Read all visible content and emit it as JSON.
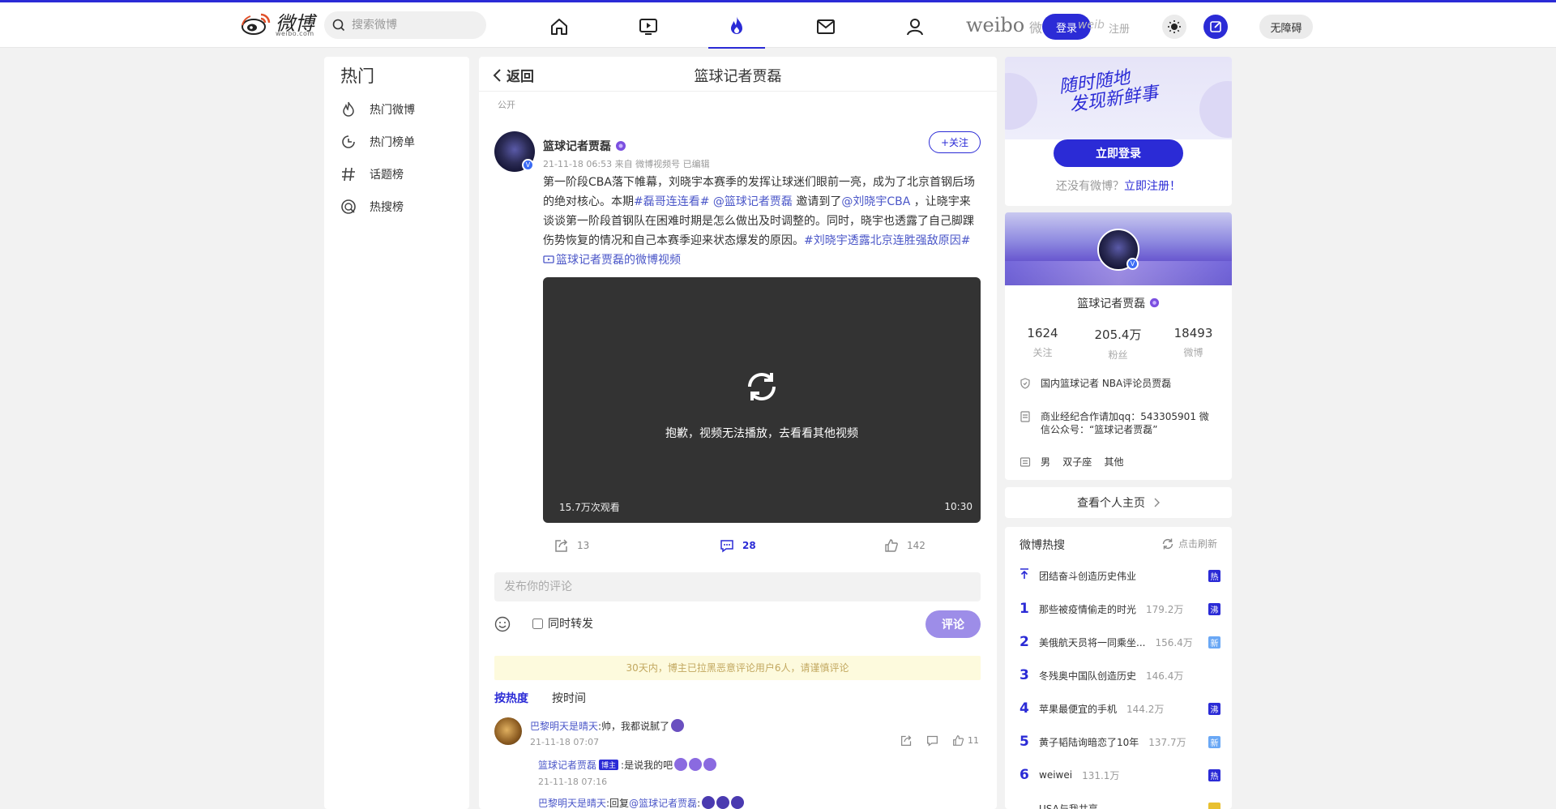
{
  "topbar": {
    "logo_text": "微博",
    "logo_sub": "weibo.com",
    "search_placeholder": "搜索微博",
    "weibo_word": "weibo",
    "weibo_shadow": "微",
    "login_label": "登录",
    "login_ghost": "weib",
    "register_ghost": "注册",
    "accessibility_label": "无障碍"
  },
  "leftnav": {
    "title": "热门",
    "items": [
      {
        "label": "热门微博",
        "icon": "flame-icon"
      },
      {
        "label": "热门榜单",
        "icon": "clock-chart-icon"
      },
      {
        "label": "话题榜",
        "icon": "hashtag-icon"
      },
      {
        "label": "热搜榜",
        "icon": "search-circle-icon"
      }
    ]
  },
  "post": {
    "back_label": "返回",
    "header_title": "篮球记者贾磊",
    "visibility": "公开",
    "author": "篮球记者贾磊",
    "meta": "21-11-18 06:53 来自 微博视频号 已编辑",
    "follow_label": "+关注",
    "body": {
      "p1": "第一阶段CBA落下帷幕，刘晓宇本赛季的发挥让球迷们眼前一亮，成为了北京首钢后场的绝对核心。本期",
      "tag1": "#磊哥连连看#",
      "mention1": "@篮球记者贾磊",
      "p2": " 邀请到了",
      "mention2": "@刘晓宇CBA",
      "p3": " ，让晓宇来谈谈第一阶段首钢队在困难时期是怎么做出及时调整的。同时，晓宇也透露了自己脚踝伤势恢复的情况和自己本赛季迎来状态爆发的原因。",
      "tag2": "#刘晓宇透露北京连胜强敌原因#",
      "video_link": "篮球记者贾磊的微博视频"
    },
    "video": {
      "message": "抱歉，视频无法播放，去看看其他视频",
      "views": "15.7万次观看",
      "duration": "10:30"
    },
    "actions": {
      "reposts": "13",
      "comments": "28",
      "likes": "142"
    },
    "comment_placeholder": "发布你的评论",
    "also_repost_label": "同时转发",
    "submit_label": "评论",
    "notice": "30天内，博主已拉黑恶意评论用户6人，请谨慎评论",
    "sort_hot": "按热度",
    "sort_time": "按时间",
    "comments": [
      {
        "user": "巴黎明天是晴天",
        "text": ":帅，我都说腻了",
        "time": "21-11-18 07:07",
        "likes": "11",
        "reply": {
          "user": "篮球记者贾磊",
          "badge": "博主",
          "text": ":是说我的吧",
          "time": "21-11-18 07:16"
        },
        "reply2": {
          "user": "巴黎明天是晴天",
          "text": ":回复",
          "mention": "@篮球记者贾磊",
          "text2": ":"
        }
      }
    ]
  },
  "sidebar": {
    "slogan_line1": "随时随地",
    "slogan_line2": "发现新鲜事",
    "login_now": "立即登录",
    "no_account": "还没有微博？",
    "register_now": "立即注册！",
    "profile": {
      "name": "篮球记者贾磊",
      "stats": [
        {
          "value": "1624",
          "label": "关注"
        },
        {
          "value": "205.4万",
          "label": "粉丝"
        },
        {
          "value": "18493",
          "label": "微博"
        }
      ],
      "info": [
        {
          "text": "国内篮球记者 NBA评论员贾磊",
          "icon": "shield-icon"
        },
        {
          "text": "商业经纪合作请加qq：543305901 微信公众号：“篮球记者贾磊”",
          "icon": "document-icon"
        },
        {
          "text": "男    双子座    其他",
          "icon": "list-icon"
        }
      ],
      "view_home": "查看个人主页"
    },
    "hotsearch": {
      "title": "微博热搜",
      "refresh": "点击刷新",
      "items": [
        {
          "rank": "",
          "word": "团结奋斗创造历史伟业",
          "heat": "",
          "tag": "热",
          "tag_color": "#2b2bd6",
          "pinned": true
        },
        {
          "rank": "1",
          "word": "那些被疫情偷走的时光",
          "heat": "179.2万",
          "tag": "沸",
          "tag_color": "#2b2bd6"
        },
        {
          "rank": "2",
          "word": "美俄航天员将一同乘坐...",
          "heat": "156.4万",
          "tag": "新",
          "tag_color": "#6aa8f5"
        },
        {
          "rank": "3",
          "word": "冬残奥中国队创造历史",
          "heat": "146.4万",
          "tag": "",
          "tag_color": ""
        },
        {
          "rank": "4",
          "word": "苹果最便宜的手机",
          "heat": "144.2万",
          "tag": "沸",
          "tag_color": "#2b2bd6"
        },
        {
          "rank": "5",
          "word": "黄子韬陆询暗恋了10年",
          "heat": "137.7万",
          "tag": "新",
          "tag_color": "#6aa8f5"
        },
        {
          "rank": "6",
          "word": "weiwei",
          "heat": "131.1万",
          "tag": "热",
          "tag_color": "#2b2bd6"
        },
        {
          "rank": "",
          "word": "USA与我共享",
          "heat": "",
          "tag": "",
          "tag_color": "#e8c030"
        }
      ]
    }
  }
}
